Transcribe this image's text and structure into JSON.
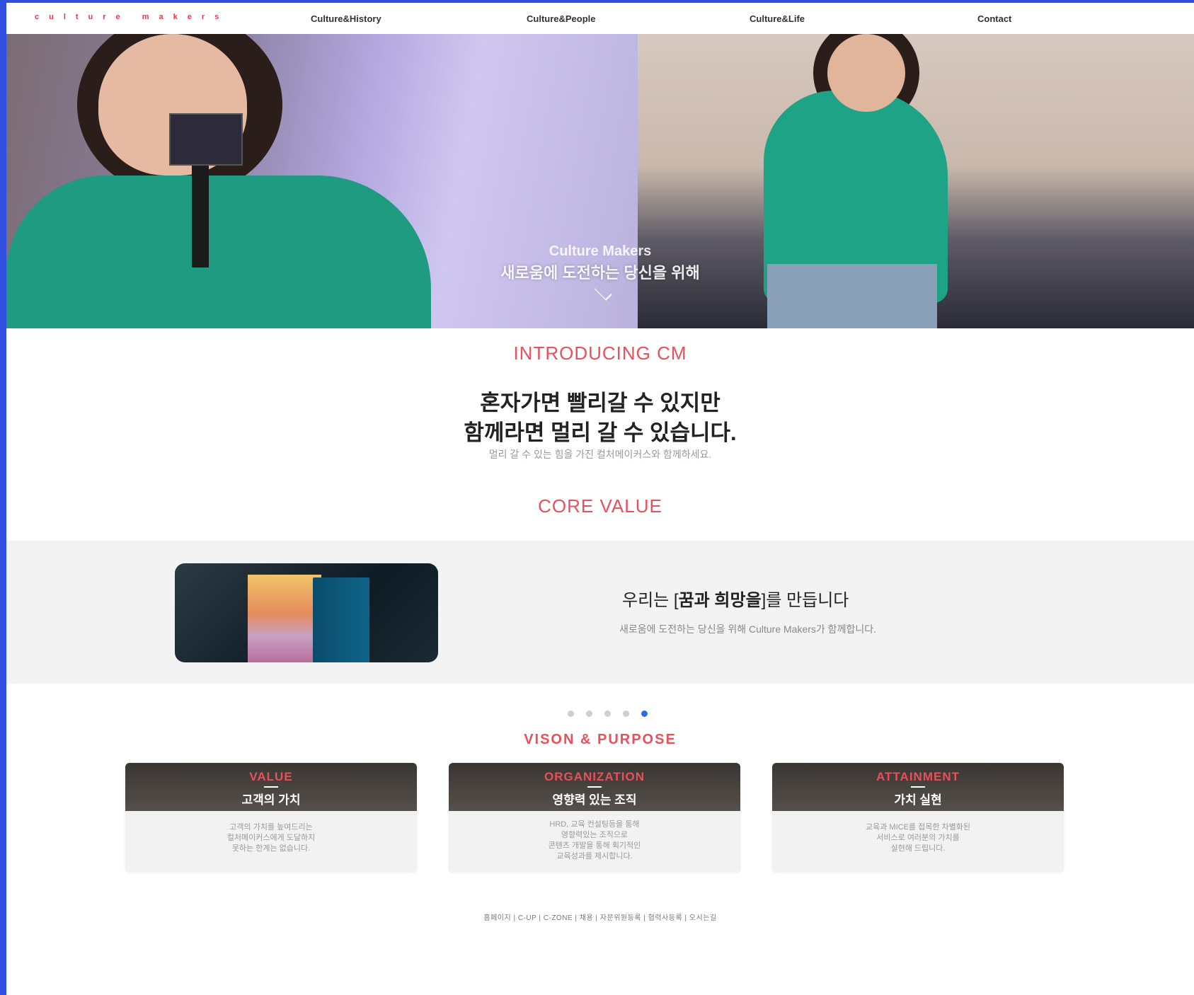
{
  "nav": {
    "logo_a": "culture",
    "logo_b": "makers",
    "items": [
      "Culture&History",
      "Culture&People",
      "Culture&Life",
      "Contact"
    ]
  },
  "hero": {
    "title": "Culture Makers",
    "subtitle": "새로움에 도전하는 당신을 위해"
  },
  "intro": {
    "heading": "INTRODUCING CM",
    "line1": "혼자가면 빨리갈 수 있지만",
    "line2": "함께라면 멀리 갈 수 있습니다.",
    "small": "멀리 갈 수 있는 힘을 가진 컬처메이커스와 함께하세요."
  },
  "core": {
    "heading": "CORE VALUE",
    "title_pre": "우리는 [",
    "title_bold": "꿈과 희망을",
    "title_post": "]를 만듭니다",
    "sub": "새로움에 도전하는 당신을 위해 Culture Makers가 함께합니다."
  },
  "slider": {
    "count": 5,
    "active": 4
  },
  "vision": {
    "heading": "VISON & PURPOSE",
    "cards": [
      {
        "en": "VALUE",
        "kr": "고객의 가치",
        "body": "고객의 가치를 높여드리는\n컬처메이커스에게 도달하지\n못하는 한계는 없습니다."
      },
      {
        "en": "ORGANIZATION",
        "kr": "영향력 있는 조직",
        "body": "HRD, 교육 컨설팅등을 통해\n영향력있는 조직으로\n콘텐츠 개발을 통해 획기적인\n교육성과를 제시합니다."
      },
      {
        "en": "ATTAINMENT",
        "kr": "가치 실현",
        "body": "교육과 MICE를 접목한 차별화된\n서비스로 여러분의 가치를\n실현해 드립니다."
      }
    ]
  },
  "footer": {
    "links": "홈페이지 | C-UP | C-ZONE | 채용 | 자문위원등록 | 협력사등록 | 오시는길"
  }
}
